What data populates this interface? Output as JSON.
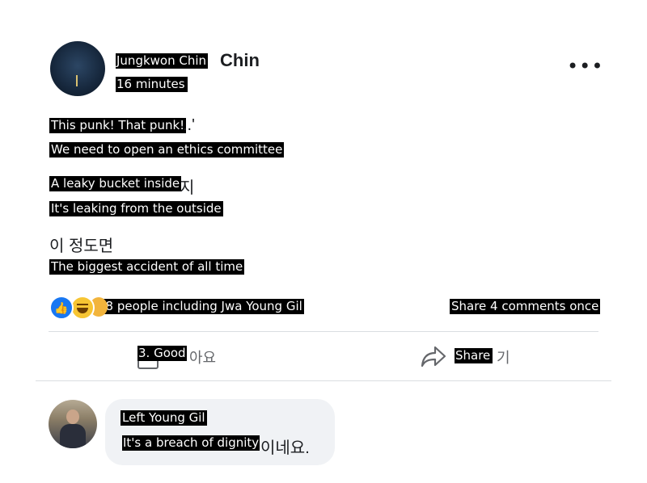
{
  "post": {
    "author_overlay": "Jungkwon Chin",
    "author_tail": "Chin",
    "time": "16 minutes",
    "more_icon": "more-horizontal-icon",
    "lines": [
      {
        "overlay": "This punk! That punk!",
        "tail": "..'"
      },
      {
        "overlay": "We need to open an ethics committee",
        "tail": ""
      },
      {
        "overlay": "A leaky bucket inside",
        "tail": "지"
      },
      {
        "overlay": "It's leaking from the outside",
        "tail": ""
      },
      {
        "overlay": "",
        "tail": "이 정도면"
      },
      {
        "overlay": "The biggest accident of all time",
        "tail": ""
      }
    ]
  },
  "reactions": {
    "summary": "78 people including Jwa Young Gil",
    "comments_share": "Share 4 comments once",
    "icons": [
      "like-reaction-icon",
      "haha-reaction-icon",
      "care-reaction-icon"
    ]
  },
  "actions": {
    "like_overlay": "3. Good",
    "like_tail": "아요",
    "share_overlay": "Share",
    "share_tail": "기"
  },
  "comment": {
    "author": "Left Young Gil",
    "text_overlay": "It's a breach of dignity",
    "text_tail": "이네요."
  },
  "colors": {
    "accent": "#1877f2",
    "secondary_text": "#65676b",
    "bubble": "#f0f2f5"
  }
}
